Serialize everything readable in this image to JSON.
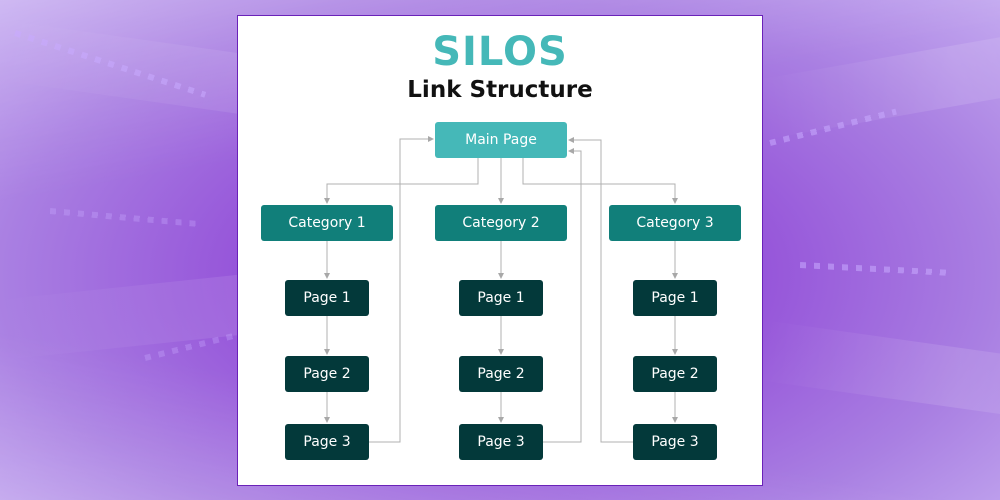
{
  "title": "SILOS",
  "subtitle": "Link Structure",
  "colors": {
    "title": "#45b8b8",
    "main_node": "#45b8b8",
    "category_node": "#117f7a",
    "page_node": "#03393a",
    "connector": "#b0b0b0",
    "background": "#8a35d2"
  },
  "main_node": {
    "label": "Main Page"
  },
  "categories": [
    {
      "label": "Category 1",
      "pages": [
        {
          "label": "Page 1"
        },
        {
          "label": "Page 2"
        },
        {
          "label": "Page 3"
        }
      ]
    },
    {
      "label": "Category 2",
      "pages": [
        {
          "label": "Page 1"
        },
        {
          "label": "Page 2"
        },
        {
          "label": "Page 3"
        }
      ]
    },
    {
      "label": "Category 3",
      "pages": [
        {
          "label": "Page 1"
        },
        {
          "label": "Page 2"
        },
        {
          "label": "Page 3"
        }
      ]
    }
  ],
  "edges": [
    {
      "from": "Main Page",
      "to": "Category 1"
    },
    {
      "from": "Main Page",
      "to": "Category 2"
    },
    {
      "from": "Main Page",
      "to": "Category 3"
    },
    {
      "from": "Category 1",
      "to": "Page 1 (Category 1)"
    },
    {
      "from": "Page 1 (Category 1)",
      "to": "Page 2 (Category 1)"
    },
    {
      "from": "Page 2 (Category 1)",
      "to": "Page 3 (Category 1)"
    },
    {
      "from": "Category 2",
      "to": "Page 1 (Category 2)"
    },
    {
      "from": "Page 1 (Category 2)",
      "to": "Page 2 (Category 2)"
    },
    {
      "from": "Page 2 (Category 2)",
      "to": "Page 3 (Category 2)"
    },
    {
      "from": "Category 3",
      "to": "Page 1 (Category 3)"
    },
    {
      "from": "Page 1 (Category 3)",
      "to": "Page 2 (Category 3)"
    },
    {
      "from": "Page 2 (Category 3)",
      "to": "Page 3 (Category 3)"
    },
    {
      "from": "Page 3 (Category 1)",
      "to": "Main Page"
    },
    {
      "from": "Page 3 (Category 2)",
      "to": "Main Page"
    },
    {
      "from": "Page 3 (Category 3)",
      "to": "Main Page"
    }
  ]
}
